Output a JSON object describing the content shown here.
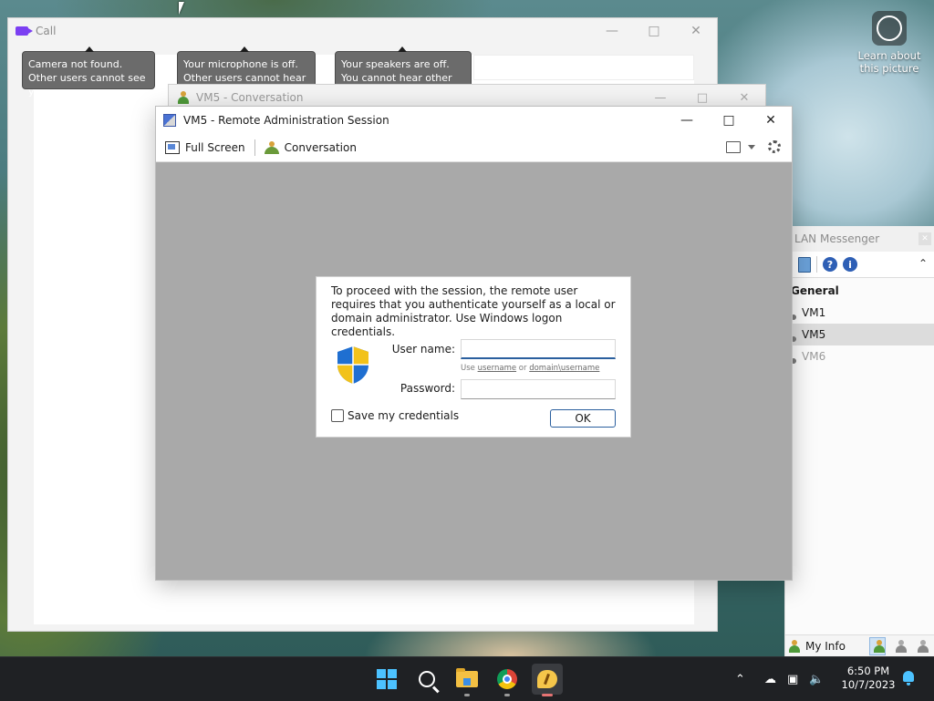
{
  "desktop": {
    "learn_about": "Learn about this picture"
  },
  "call_window": {
    "title": "Call",
    "tooltips": [
      {
        "line1": "Camera not found.",
        "line2": "Other users cannot see you."
      },
      {
        "line1": "Your microphone is off.",
        "line2": "Other users cannot hear you."
      },
      {
        "line1": "Your speakers are off.",
        "line2": "You cannot hear other users."
      }
    ]
  },
  "conversation_window": {
    "title": "VM5 - Conversation"
  },
  "lan_messenger": {
    "title": "LAN Messenger",
    "group": "General",
    "contacts": [
      "VM1",
      "VM5",
      "VM6"
    ],
    "selected_contact": "VM5",
    "my_info_label": "My Info"
  },
  "remote_session": {
    "title": "VM5 - Remote Administration Session",
    "toolbar": {
      "full_screen_label": "Full Screen",
      "conversation_label": "Conversation"
    }
  },
  "auth_dialog": {
    "message": "To proceed with the session, the remote user requires that you authenticate yourself as a local or domain administrator. Use Windows logon credentials.",
    "username_label": "User name:",
    "username_value": "",
    "hint_prefix": "Use",
    "hint_username": "username",
    "hint_or": "or",
    "hint_domain": "domain\\username",
    "password_label": "Password:",
    "password_value": "",
    "save_credentials_label": "Save my credentials",
    "save_credentials_checked": false,
    "ok_label": "OK"
  },
  "taskbar": {
    "clock_time": "6:50 PM",
    "clock_date": "10/7/2023"
  },
  "colors": {
    "accent": "#2a5f9e",
    "desktop_teal": "#3e6f73",
    "taskbar": "#1f2124",
    "session_gray": "#a9a9a9"
  }
}
